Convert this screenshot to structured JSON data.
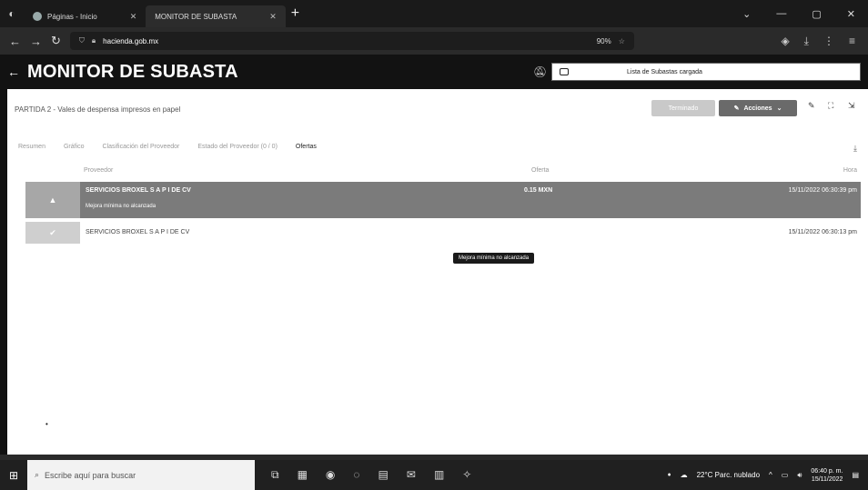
{
  "browser": {
    "tabs": [
      {
        "label": "Páginas - Inicio",
        "active": false
      },
      {
        "label": "MONITOR DE SUBASTA",
        "active": true
      }
    ],
    "new_tab_symbol": "+",
    "url_host": "hacienda.gob.mx",
    "zoom": "90%"
  },
  "app": {
    "back_symbol": "←",
    "title": "MONITOR DE SUBASTA",
    "notice": "Lista de Subastas cargada"
  },
  "partida": "PARTIDA 2 - Vales de despensa impresos en papel",
  "buttons": {
    "terminado": "Terminado",
    "acciones": "Acciones"
  },
  "tabs": [
    {
      "label": "Resumen",
      "active": false
    },
    {
      "label": "Gráfico",
      "active": false
    },
    {
      "label": "Clasificación del Proveedor",
      "active": false
    },
    {
      "label": "Estado del Proveedor (0 / 0)",
      "active": false
    },
    {
      "label": "Ofertas",
      "active": true
    }
  ],
  "columns": {
    "proveedor": "Proveedor",
    "oferta": "Oferta",
    "hora": "Hora"
  },
  "rows": [
    {
      "proveedor": "SERVICIOS BROXEL S A P I DE CV",
      "sub": "Mejora mínima no alcanzada",
      "oferta": "0.15 MXN",
      "hora": "15/11/2022 06:30:39 pm",
      "status_icon": "warning-icon"
    },
    {
      "proveedor": "SERVICIOS BROXEL S A P I DE CV",
      "oferta": "",
      "hora": "15/11/2022 06:30:13 pm",
      "status_icon": "check-icon"
    }
  ],
  "tooltip": "Mejora mínima no alcanzada",
  "taskbar": {
    "search_placeholder": "Escribe aquí para buscar",
    "weather": "22°C Parc. nublado",
    "time": "06:40 p. m.",
    "date": "15/11/2022"
  },
  "colors": {
    "selected_row": "#7b7b7b",
    "header_bg": "#121212",
    "page_bg": "#ffffff"
  }
}
